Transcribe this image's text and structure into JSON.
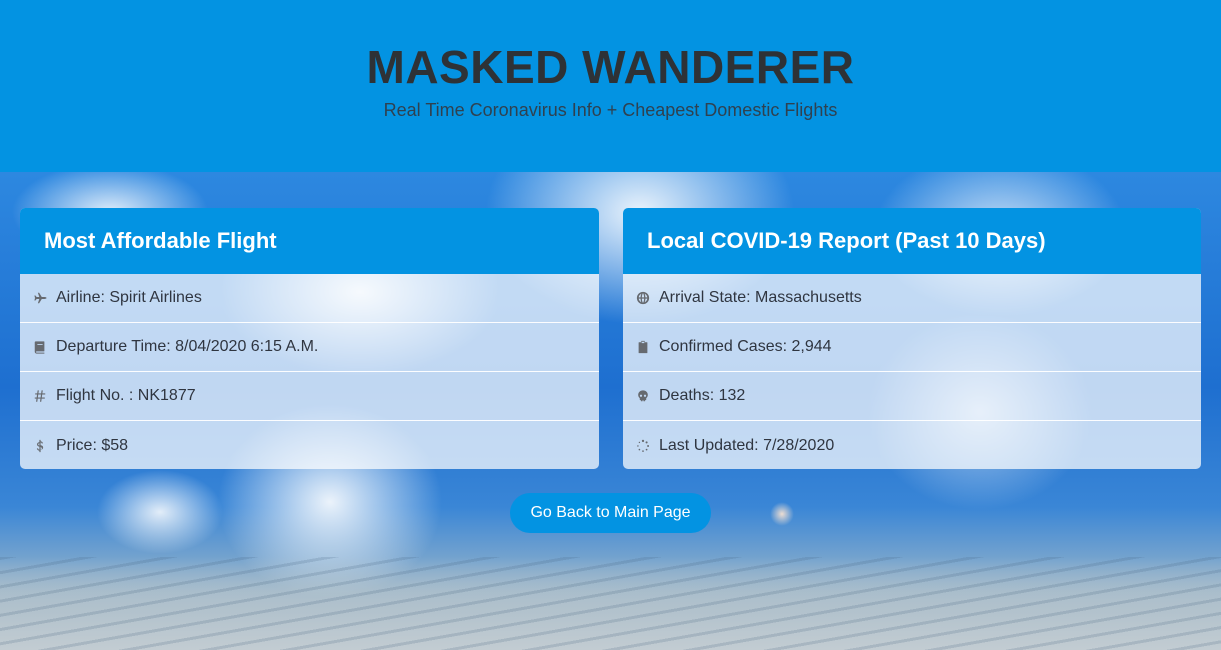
{
  "header": {
    "title": "MASKED WANDERER",
    "subtitle": "Real Time Coronavirus Info + Cheapest Domestic Flights"
  },
  "flight_card": {
    "title": "Most Affordable Flight",
    "rows": [
      {
        "icon": "plane-icon",
        "text": "Airline: Spirit Airlines"
      },
      {
        "icon": "book-icon",
        "text": "Departure Time: 8/04/2020 6:15 A.M."
      },
      {
        "icon": "hashtag-icon",
        "text": "Flight No. : NK1877"
      },
      {
        "icon": "dollar-icon",
        "text": "Price: $58"
      }
    ]
  },
  "covid_card": {
    "title": "Local COVID-19 Report (Past 10 Days)",
    "rows": [
      {
        "icon": "globe-icon",
        "text": "Arrival State: Massachusetts"
      },
      {
        "icon": "clipboard-icon",
        "text": "Confirmed Cases: 2,944"
      },
      {
        "icon": "skull-icon",
        "text": "Deaths: 132"
      },
      {
        "icon": "spinner-icon",
        "text": "Last Updated: 7/28/2020"
      }
    ]
  },
  "actions": {
    "back_label": "Go Back to Main Page"
  },
  "colors": {
    "accent": "#0393e2",
    "title_text": "#2e3236",
    "row_text": "#2f3540",
    "icon": "#666a70"
  }
}
